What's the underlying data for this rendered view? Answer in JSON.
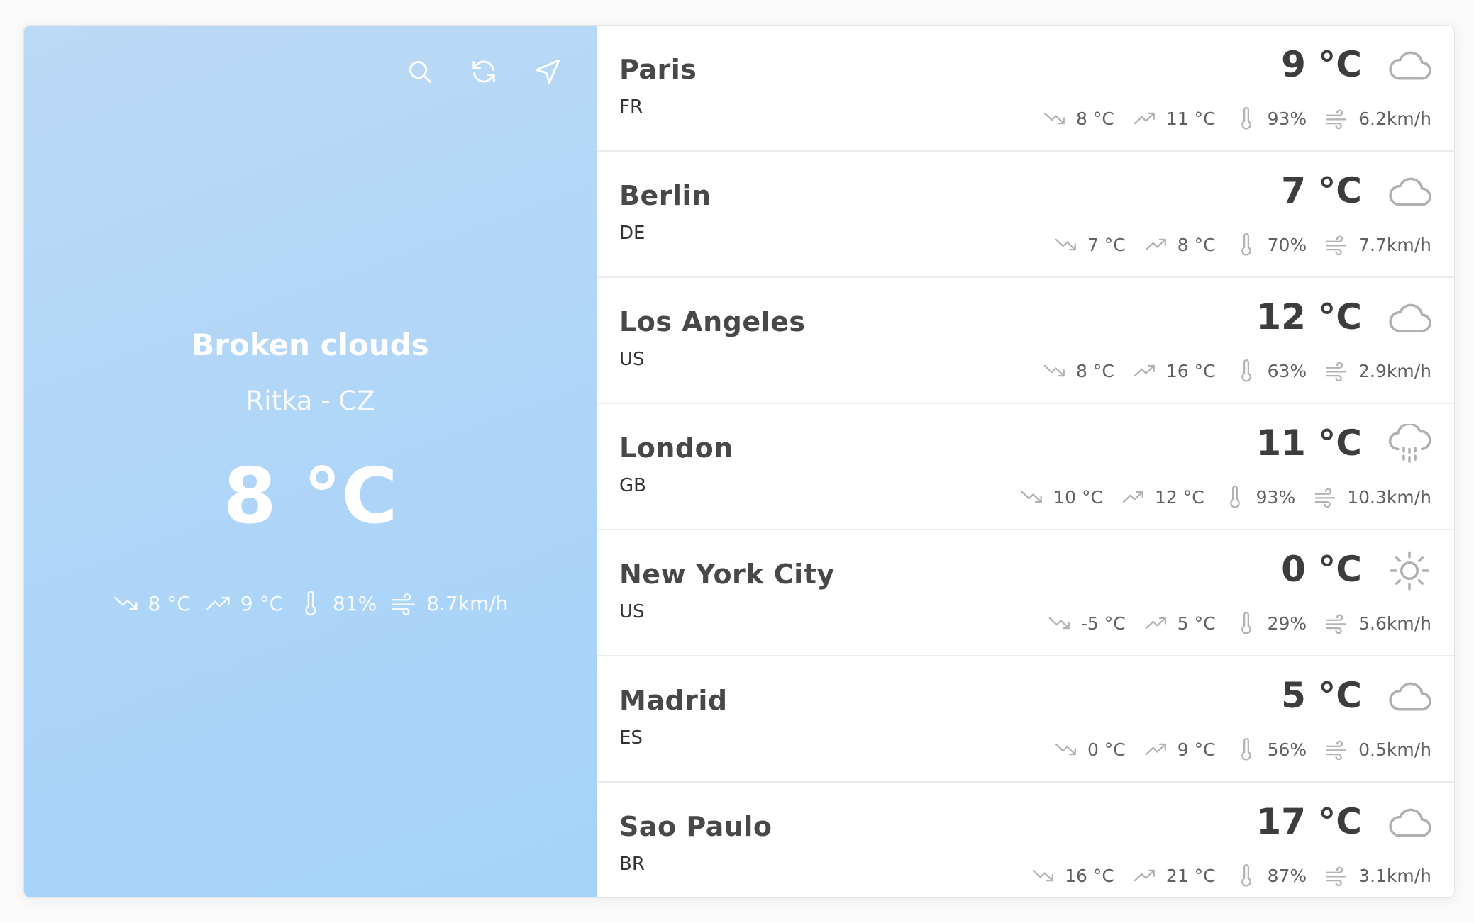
{
  "current": {
    "description": "Broken clouds",
    "location": "Ritka - CZ",
    "temperature": "8 °C",
    "min": "8 °C",
    "max": "9 °C",
    "humidity": "81%",
    "wind": "8.7km/h"
  },
  "toolbar": {
    "search_icon": "search-icon",
    "refresh_icon": "refresh-icon",
    "locate_icon": "location-arrow-icon"
  },
  "cities": [
    {
      "name": "Paris",
      "country": "FR",
      "temp": "9 °C",
      "min": "8 °C",
      "max": "11 °C",
      "humidity": "93%",
      "wind": "6.2km/h",
      "icon": "cloud-icon"
    },
    {
      "name": "Berlin",
      "country": "DE",
      "temp": "7 °C",
      "min": "7 °C",
      "max": "8 °C",
      "humidity": "70%",
      "wind": "7.7km/h",
      "icon": "cloud-icon"
    },
    {
      "name": "Los Angeles",
      "country": "US",
      "temp": "12 °C",
      "min": "8 °C",
      "max": "16 °C",
      "humidity": "63%",
      "wind": "2.9km/h",
      "icon": "cloud-icon"
    },
    {
      "name": "London",
      "country": "GB",
      "temp": "11 °C",
      "min": "10 °C",
      "max": "12 °C",
      "humidity": "93%",
      "wind": "10.3km/h",
      "icon": "rain-icon"
    },
    {
      "name": "New York City",
      "country": "US",
      "temp": "0 °C",
      "min": "-5 °C",
      "max": "5 °C",
      "humidity": "29%",
      "wind": "5.6km/h",
      "icon": "sun-icon"
    },
    {
      "name": "Madrid",
      "country": "ES",
      "temp": "5 °C",
      "min": "0 °C",
      "max": "9 °C",
      "humidity": "56%",
      "wind": "0.5km/h",
      "icon": "cloud-icon"
    },
    {
      "name": "Sao Paulo",
      "country": "BR",
      "temp": "17 °C",
      "min": "16 °C",
      "max": "21 °C",
      "humidity": "87%",
      "wind": "3.1km/h",
      "icon": "cloud-icon"
    }
  ],
  "colors": {
    "panel_bg": "#b3d6f7",
    "text_dark": "#444444",
    "icon_gray": "#b0b0b0"
  }
}
